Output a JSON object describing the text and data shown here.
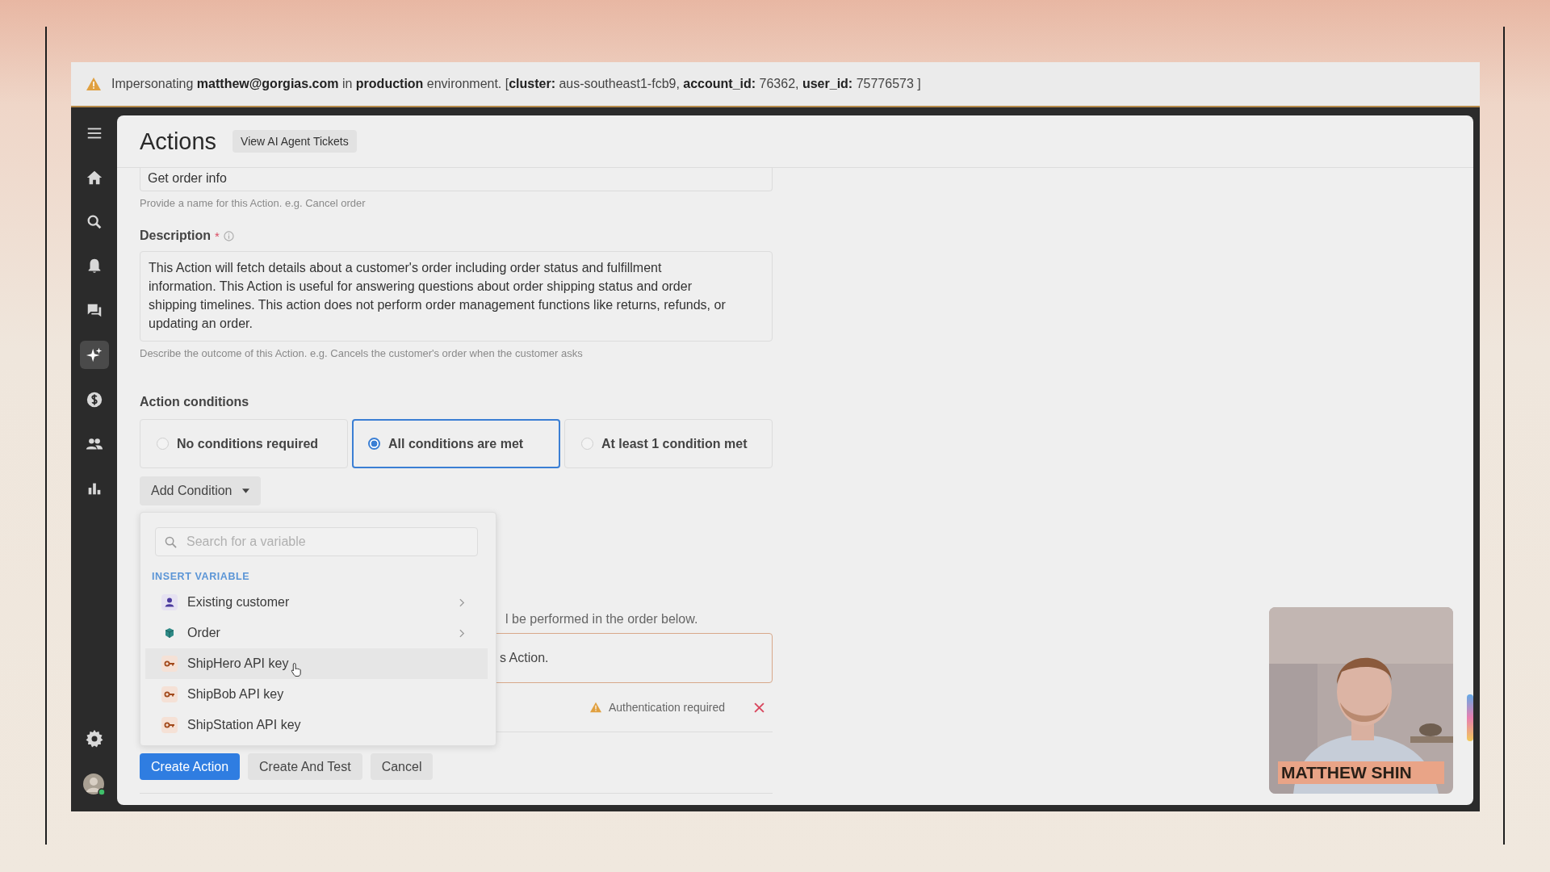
{
  "banner": {
    "text": "Impersonating **matthew@gorgias.com** in **production** environment. [**cluster:** aus-southeast1-fcb9, **account_id:** 76362, **user_id:** 75776573 ]"
  },
  "sidebar": {
    "items": [
      {
        "selected": false
      },
      {
        "selected": false
      },
      {
        "selected": false
      },
      {
        "selected": false
      },
      {
        "selected": false
      },
      {
        "selected": true
      },
      {
        "selected": false
      },
      {
        "selected": false
      },
      {
        "selected": false
      }
    ]
  },
  "header": {
    "title": "Actions",
    "button": "View AI Agent Tickets"
  },
  "name_field": {
    "value": "Get order info",
    "help": "Provide a name for this Action. e.g. Cancel order"
  },
  "description": {
    "label": "Description",
    "required_mark": "*",
    "value": "This Action will fetch details about a customer's order including order status and fulfillment information. This Action is useful for answering questions about order shipping status and order shipping timelines. This action does not perform order management functions like returns, refunds, or updating an order.",
    "help": "Describe the outcome of this Action. e.g. Cancels the customer's order when the customer asks"
  },
  "conditions": {
    "label": "Action conditions",
    "options": [
      {
        "label": "No conditions required",
        "selected": false
      },
      {
        "label": "All conditions are met",
        "selected": true
      },
      {
        "label": "At least 1 condition met",
        "selected": false
      }
    ],
    "add_button": "Add Condition"
  },
  "steps": {
    "hint": "l be performed in the order below.",
    "box_text": "s Action.",
    "warning": "Authentication required"
  },
  "buttons": [
    {
      "label": "Create Action",
      "kind": "primary"
    },
    {
      "label": "Create And Test",
      "kind": "secondary"
    },
    {
      "label": "Cancel",
      "kind": "secondary"
    }
  ],
  "variable_menu": {
    "placeholder": "Search for a variable",
    "heading": "INSERT VARIABLE",
    "items": [
      {
        "label": "Existing customer",
        "kind": "customer",
        "hovered": false
      },
      {
        "label": "Order",
        "kind": "order",
        "hovered": false
      },
      {
        "label": "ShipHero API key",
        "kind": "secret",
        "hovered": true
      },
      {
        "label": "ShipBob API key",
        "kind": "secret",
        "hovered": false
      },
      {
        "label": "ShipStation API key",
        "kind": "secret",
        "hovered": false
      }
    ]
  },
  "webcam": {
    "kind": "picture",
    "caption": "MATTHEW SHIN"
  }
}
